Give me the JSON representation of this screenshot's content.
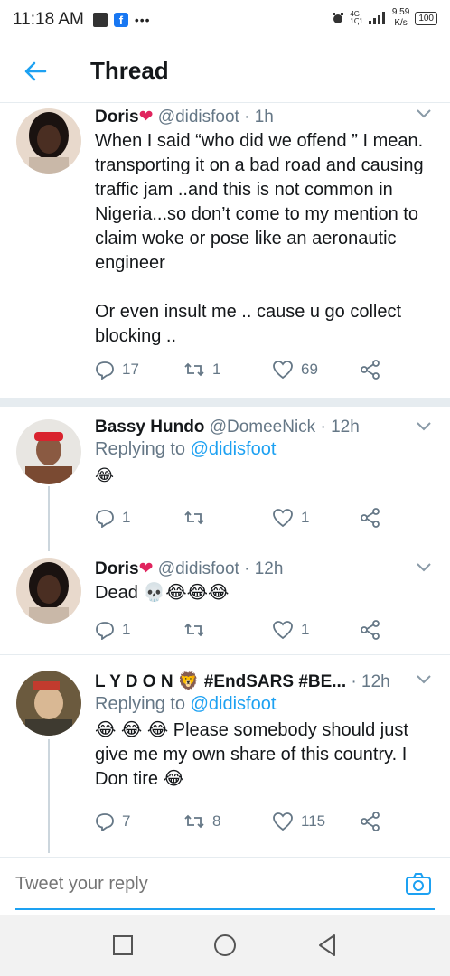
{
  "status_bar": {
    "time": "11:18 AM",
    "dots": "•••",
    "network": "4G",
    "network_sub": "1ↅ1",
    "speed_value": "9.59",
    "speed_unit": "K/s",
    "battery": "100"
  },
  "header": {
    "title": "Thread"
  },
  "tweets": [
    {
      "name": "Doris",
      "heart": "❤",
      "meta": " @didisfoot · 1h",
      "text_line1": "When I said “who did we offend ” I mean. transporting it on a bad road and causing traffic jam ..and this is not common in Nigeria...so don’t come to my mention to claim woke or pose like an aeronautic engineer",
      "text_line2": "Or even insult me .. cause u go collect blocking ..",
      "replies": "17",
      "retweets": "1",
      "likes": "69"
    },
    {
      "name": "Bassy Hundo",
      "meta": " @DomeeNick · 12h",
      "replying": "Replying to ",
      "replying_handle": "@didisfoot",
      "text": "😂",
      "replies": "1",
      "retweets": "",
      "likes": "1"
    },
    {
      "name": "Doris",
      "heart": "❤",
      "meta": " @didisfoot · 12h",
      "text": "Dead 💀😂😂😂",
      "replies": "1",
      "retweets": "",
      "likes": "1"
    },
    {
      "name": "L Y D O N 🦁 #EndSARS #BE...",
      "meta": " · 12h",
      "replying": "Replying to ",
      "replying_handle": "@didisfoot",
      "text": "😂 😂 😂 Please somebody should just give me my own share of this country. I Don tire 😂",
      "replies": "7",
      "retweets": "8",
      "likes": "115"
    }
  ],
  "composer": {
    "placeholder": "Tweet your reply"
  },
  "colors": {
    "accent": "#1da1f2",
    "muted": "#657786",
    "heart": "#e0245e"
  }
}
